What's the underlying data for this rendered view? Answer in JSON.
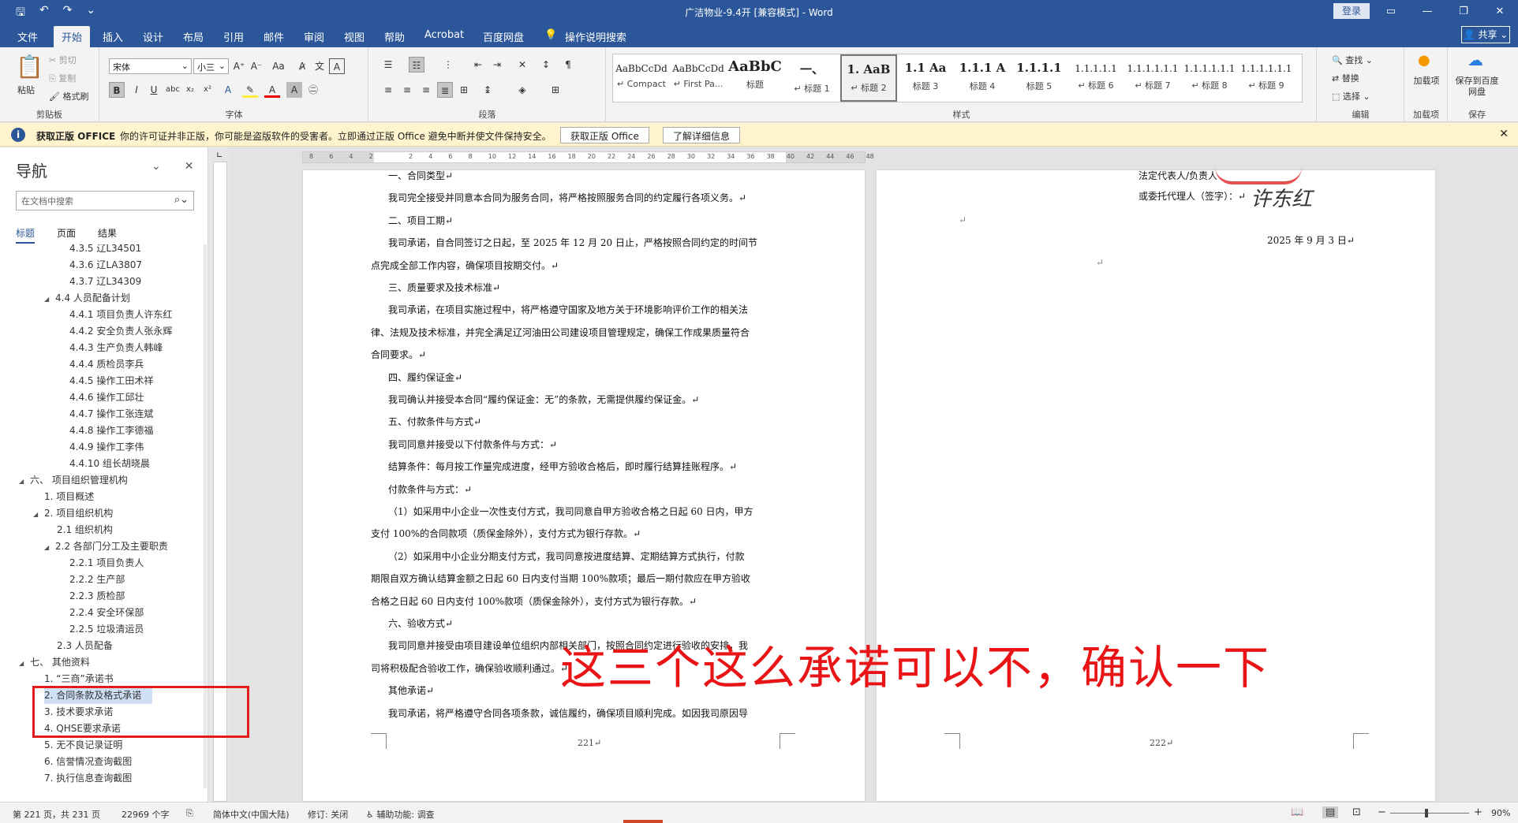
{
  "window": {
    "title": "广洁物业-9.4开 [兼容模式] - Word",
    "login": "登录",
    "share": "共享"
  },
  "tabs": [
    "文件",
    "开始",
    "插入",
    "设计",
    "布局",
    "引用",
    "邮件",
    "审阅",
    "视图",
    "帮助",
    "Acrobat",
    "百度网盘",
    "操作说明搜索"
  ],
  "ribbon": {
    "clipboard": {
      "paste": "粘贴",
      "cut": "剪切",
      "copy": "复制",
      "painter": "格式刷",
      "label": "剪贴板"
    },
    "font": {
      "name": "宋体",
      "size": "小三",
      "label": "字体"
    },
    "paragraph": {
      "label": "段落"
    },
    "styles": {
      "label": "样式",
      "items": [
        {
          "preview": "AaBbCcDd",
          "name": "Compact"
        },
        {
          "preview": "AaBbCcDd",
          "name": "First Pa..."
        },
        {
          "preview": "AaBbC",
          "name": "标题"
        },
        {
          "preview": "一、",
          "name": "标题 1"
        },
        {
          "preview": "1. AaB",
          "name": "标题 2"
        },
        {
          "preview": "1.1 Aa",
          "name": "标题 3"
        },
        {
          "preview": "1.1.1 A",
          "name": "标题 4"
        },
        {
          "preview": "1.1.1.1",
          "name": "标题 5"
        },
        {
          "preview": "1.1.1.1.1",
          "name": "标题 6"
        },
        {
          "preview": "1.1.1.1.1.1",
          "name": "标题 7"
        },
        {
          "preview": "1.1.1.1.1.1",
          "name": "标题 8"
        },
        {
          "preview": "1.1.1.1.1.1",
          "name": "标题 9"
        }
      ]
    },
    "editing": {
      "find": "查找",
      "replace": "替换",
      "select": "选择",
      "label": "编辑"
    },
    "addins": {
      "btn": "加载项",
      "label": "加载项"
    },
    "save": {
      "btn": "保存到百度网盘",
      "label": "保存"
    }
  },
  "infobar": {
    "title": "获取正版 OFFICE",
    "message": "你的许可证并非正版，你可能是盗版软件的受害者。立即通过正版 Office 避免中断并使文件保持安全。",
    "btn1": "获取正版 Office",
    "btn2": "了解详细信息"
  },
  "nav": {
    "title": "导航",
    "search_placeholder": "在文档中搜索",
    "tabs": [
      "标题",
      "页面",
      "结果"
    ],
    "items": [
      {
        "text": "4.3.5 辽L34501",
        "level": 3
      },
      {
        "text": "4.3.6 辽LA3807",
        "level": 3
      },
      {
        "text": "4.3.7 辽L34309",
        "level": 3
      },
      {
        "text": "4.4 人员配备计划",
        "level": 2,
        "expanded": true
      },
      {
        "text": "4.4.1 项目负责人许东红",
        "level": 3
      },
      {
        "text": "4.4.2 安全负责人张永辉",
        "level": 3
      },
      {
        "text": "4.4.3 生产负责人韩峰",
        "level": 3
      },
      {
        "text": "4.4.4 质检员李兵",
        "level": 3
      },
      {
        "text": "4.4.5 操作工田术祥",
        "level": 3
      },
      {
        "text": "4.4.6 操作工邱壮",
        "level": 3
      },
      {
        "text": "4.4.7 操作工张连斌",
        "level": 3
      },
      {
        "text": "4.4.8 操作工李德福",
        "level": 3
      },
      {
        "text": "4.4.9 操作工李伟",
        "level": 3
      },
      {
        "text": "4.4.10 组长胡晓晨",
        "level": 3
      },
      {
        "text": "六、 项目组织管理机构",
        "level": 0,
        "expanded": true
      },
      {
        "text": "1. 项目概述",
        "level": 1
      },
      {
        "text": "2. 项目组织机构",
        "level": 1,
        "expanded": true
      },
      {
        "text": "2.1 组织机构",
        "level": 2
      },
      {
        "text": "2.2 各部门分工及主要职责",
        "level": 2,
        "expanded": true
      },
      {
        "text": "2.2.1 项目负责人",
        "level": 3
      },
      {
        "text": "2.2.2 生产部",
        "level": 3
      },
      {
        "text": "2.2.3 质检部",
        "level": 3
      },
      {
        "text": "2.2.4 安全环保部",
        "level": 3
      },
      {
        "text": "2.2.5 垃圾清运员",
        "level": 3
      },
      {
        "text": "2.3 人员配备",
        "level": 2
      },
      {
        "text": "七、 其他资料",
        "level": 0,
        "expanded": true
      },
      {
        "text": "1. “三商”承诺书",
        "level": 1
      },
      {
        "text": "2. 合同条款及格式承诺",
        "level": 1,
        "selected": true
      },
      {
        "text": "3. 技术要求承诺",
        "level": 1
      },
      {
        "text": "4. QHSE要求承诺",
        "level": 1
      },
      {
        "text": "5. 无不良记录证明",
        "level": 1
      },
      {
        "text": "6. 信誉情况查询截图",
        "level": 1
      },
      {
        "text": "7. 执行信息查询截图",
        "level": 1
      }
    ]
  },
  "ruler": {
    "ticks": [
      "8",
      "6",
      "4",
      "2",
      "",
      "2",
      "4",
      "6",
      "8",
      "10",
      "12",
      "14",
      "16",
      "18",
      "20",
      "22",
      "24",
      "26",
      "28",
      "30",
      "32",
      "34",
      "36",
      "38",
      "40",
      "42",
      "44",
      "46",
      "48"
    ]
  },
  "page1": {
    "lines": [
      "一、合同类型↵",
      "我司完全接受并同意本合同为服务合同，将严格按照服务合同的约定履行各项义务。↵",
      "二、项目工期↵",
      "我司承诺，自合同签订之日起，至 2025 年 12 月 20 日止，严格按照合同约定的时间节",
      "点完成全部工作内容，确保项目按期交付。↵",
      "三、质量要求及技术标准↵",
      "我司承诺，在项目实施过程中，将严格遵守国家及地方关于环境影响评价工作的相关法",
      "律、法规及技术标准，并完全满足辽河油田公司建设项目管理规定，确保工作成果质量符合",
      "合同要求。↵",
      "四、履约保证金↵",
      "我司确认并接受本合同“履约保证金：无”的条款，无需提供履约保证金。↵",
      "五、付款条件与方式↵",
      "我司同意并接受以下付款条件与方式：↵",
      "结算条件：每月按工作量完成进度，经甲方验收合格后，即时履行结算挂账程序。↵",
      "付款条件与方式：↵",
      "（1）如采用中小企业一次性支付方式，我司同意自甲方验收合格之日起 60 日内，甲方",
      "支付 100%的合同款项（质保金除外），支付方式为银行存款。↵",
      "（2）如采用中小企业分期支付方式，我司同意按进度结算、定期结算方式执行，付款",
      "期限自双方确认结算金额之日起 60 日内支付当期 100%款项；最后一期付款应在甲方验收",
      "合格之日起 60 日内支付 100%款项（质保金除外），支付方式为银行存款。↵",
      "六、验收方式↵",
      "我司同意并接受由项目建设单位组织内部相关部门，按照合同约定进行验收的安排，我",
      "司将积极配合验收工作，确保验收顺利通过。↵",
      "其他承诺↵",
      "我司承诺，将严格遵守合同各项条款，诚信履约，确保项目顺利完成。如因我司原因导"
    ],
    "page_number": "221↵"
  },
  "page2": {
    "rep": "法定代表人/负责人",
    "agent": "或委托代理人（签字）：↵",
    "date": "2025 年 9 月 3 日↵",
    "mark1": "↵",
    "mark2": "↵",
    "page_number": "222↵"
  },
  "annotation": "这三个这么承诺可以不，确认一下",
  "status": {
    "page": "第 221 页，共 231 页",
    "words": "22969 个字",
    "lang": "简体中文(中国大陆)",
    "track": "修订: 关闭",
    "access": "辅助功能: 调查",
    "zoom": "90%"
  }
}
